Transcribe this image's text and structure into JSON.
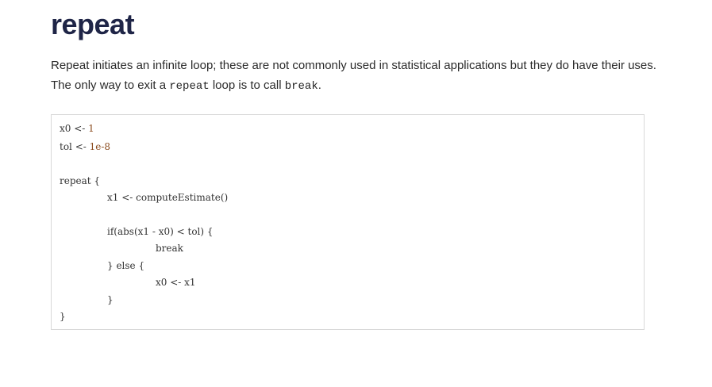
{
  "title": "repeat",
  "intro": {
    "text_before": "Repeat initiates an infinite loop; these are not commonly used in statistical applications but they do have their uses. The only way to exit a ",
    "code_repeat": "repeat",
    "text_middle": " loop is to call ",
    "code_break": "break",
    "text_after": "."
  },
  "code": {
    "line1_text": "x0 <- ",
    "line1_num": "1",
    "line2_text": "tol <- ",
    "line2_num": "1e-8",
    "line3": "repeat {",
    "line4": "x1 <- computeEstimate()",
    "line5": "if(abs(x1 - x0) < tol) {",
    "line6": "break",
    "line7": "} else {",
    "line8": "x0 <- x1",
    "line9": "}",
    "line10": "}"
  }
}
